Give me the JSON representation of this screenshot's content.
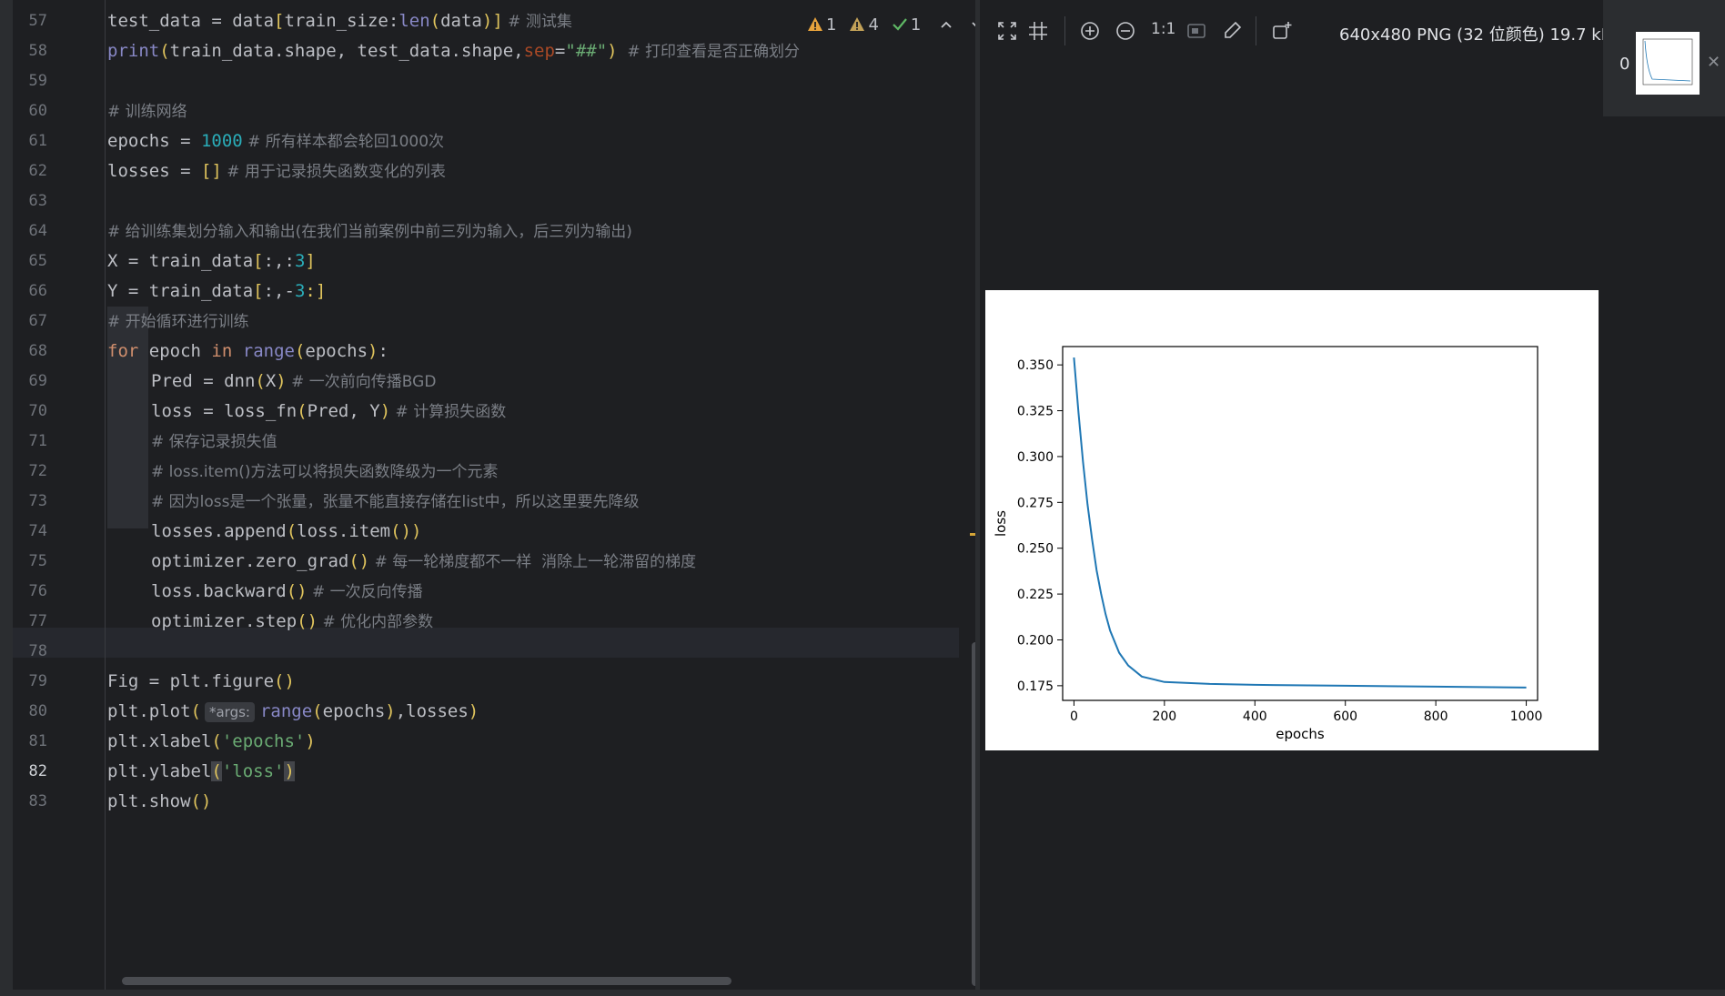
{
  "editor": {
    "current_line": "82",
    "lines": [
      {
        "n": "57"
      },
      {
        "n": "58"
      },
      {
        "n": "59"
      },
      {
        "n": "60"
      },
      {
        "n": "61"
      },
      {
        "n": "62"
      },
      {
        "n": "63"
      },
      {
        "n": "64"
      },
      {
        "n": "65"
      },
      {
        "n": "66"
      },
      {
        "n": "67"
      },
      {
        "n": "68"
      },
      {
        "n": "69"
      },
      {
        "n": "70"
      },
      {
        "n": "71"
      },
      {
        "n": "72"
      },
      {
        "n": "73"
      },
      {
        "n": "74"
      },
      {
        "n": "75"
      },
      {
        "n": "76"
      },
      {
        "n": "77"
      },
      {
        "n": "78"
      },
      {
        "n": "79"
      },
      {
        "n": "80"
      },
      {
        "n": "81"
      },
      {
        "n": "82"
      },
      {
        "n": "83"
      }
    ],
    "code": {
      "l57_a": "test_data = data",
      "l57_b": "[",
      "l57_c": "train_size:",
      "l57_d": "len",
      "l57_e": "(",
      "l57_f": "data",
      "l57_g": ")",
      "l57_h": "]",
      "l57_cmt": " # 测试集",
      "l58_a": "print",
      "l58_b": "(",
      "l58_c": "train_data.shape, test_data.shape,",
      "l58_d": "sep",
      "l58_e": "=",
      "l58_f": "\"##\"",
      "l58_g": ")",
      "l58_cmt": "  # 打印查看是否正确划分",
      "l60_cmt": "# 训练网络",
      "l61_a": "epochs = ",
      "l61_b": "1000",
      "l61_cmt": " # 所有样本都会轮回1000次",
      "l62_a": "losses = ",
      "l62_b": "[]",
      "l62_cmt": " # 用于记录损失函数变化的列表",
      "l64_cmt": "# 给训练集划分输入和输出(在我们当前案例中前三列为输入，后三列为输出)",
      "l65_a": "X = train_data",
      "l65_b": "[",
      "l65_c": ":,:",
      "l65_d": "3",
      "l65_e": "]",
      "l66_a": "Y = train_data",
      "l66_b": "[",
      "l66_c": ":,-",
      "l66_d": "3",
      "l66_e": ":]",
      "l67_cmt": "# 开始循环进行训练",
      "l68_a": "for",
      "l68_b": " epoch ",
      "l68_c": "in",
      "l68_d": " ",
      "l68_e": "range",
      "l68_f": "(",
      "l68_g": "epochs",
      "l68_h": ")",
      "l68_i": ":",
      "l69_a": "Pred = dnn",
      "l69_b": "(",
      "l69_c": "X",
      "l69_d": ")",
      "l69_cmt": " # 一次前向传播BGD",
      "l70_a": "loss = loss_fn",
      "l70_b": "(",
      "l70_c": "Pred, Y",
      "l70_d": ")",
      "l70_cmt": " # 计算损失函数",
      "l71_cmt": "# 保存记录损失值",
      "l72_cmt": "# loss.item()方法可以将损失函数降级为一个元素",
      "l73_cmt": "# 因为loss是一个张量，张量不能直接存储在list中，所以这里要先降级",
      "l74_a": "losses.append",
      "l74_b": "(",
      "l74_c": "loss.item",
      "l74_d": "()",
      "l74_e": ")",
      "l75_a": "optimizer.zero_grad",
      "l75_b": "()",
      "l75_cmt": " # 每一轮梯度都不一样  消除上一轮滞留的梯度",
      "l76_a": "loss.backward",
      "l76_b": "()",
      "l76_cmt": " # 一次反向传播",
      "l77_a": "optimizer.step",
      "l77_b": "()",
      "l77_cmt": " # 优化内部参数",
      "l79_a": "Fig = plt.figure",
      "l79_b": "()",
      "l80_a": "plt.plot",
      "l80_b": "(",
      "l80_hint": "*args:",
      "l80_c": "range",
      "l80_d": "(",
      "l80_e": "epochs",
      "l80_f": ")",
      "l80_g": ",losses",
      "l80_h": ")",
      "l81_a": "plt.xlabel",
      "l81_b": "(",
      "l81_c": "'epochs'",
      "l81_d": ")",
      "l82_a": "plt.ylabel",
      "l82_b": "(",
      "l82_c": "'loss'",
      "l82_d": ")",
      "l83_a": "plt.show",
      "l83_b": "()"
    },
    "inspections": {
      "warnings_red": "1",
      "warnings": "4",
      "ok": "1"
    }
  },
  "viewer": {
    "zoom_label": "1:1",
    "image_info": "640x480 PNG (32 位颜色) 19.7 kB",
    "thumbnail_index": "0",
    "toolbar_icons": [
      "fit-screen-icon",
      "grid-icon",
      "zoom-in-icon",
      "zoom-out-icon",
      "actual-size-label",
      "background-icon",
      "color-picker-icon",
      "external-editor-icon"
    ]
  },
  "chart_data": {
    "type": "line",
    "xlabel": "epochs",
    "ylabel": "loss",
    "xlim": [
      -25,
      1025
    ],
    "ylim": [
      0.167,
      0.36
    ],
    "xticks": [
      0,
      200,
      400,
      600,
      800,
      1000
    ],
    "yticks": [
      0.175,
      0.2,
      0.225,
      0.25,
      0.275,
      0.3,
      0.325,
      0.35
    ],
    "x": [
      0,
      10,
      20,
      30,
      40,
      50,
      60,
      70,
      80,
      100,
      120,
      150,
      200,
      300,
      400,
      600,
      800,
      1000
    ],
    "series": [
      {
        "color": "#1f77b4",
        "values": [
          0.354,
          0.324,
          0.297,
          0.274,
          0.255,
          0.238,
          0.225,
          0.214,
          0.205,
          0.193,
          0.186,
          0.18,
          0.177,
          0.176,
          0.1755,
          0.175,
          0.1745,
          0.174
        ]
      }
    ],
    "grid": false
  }
}
